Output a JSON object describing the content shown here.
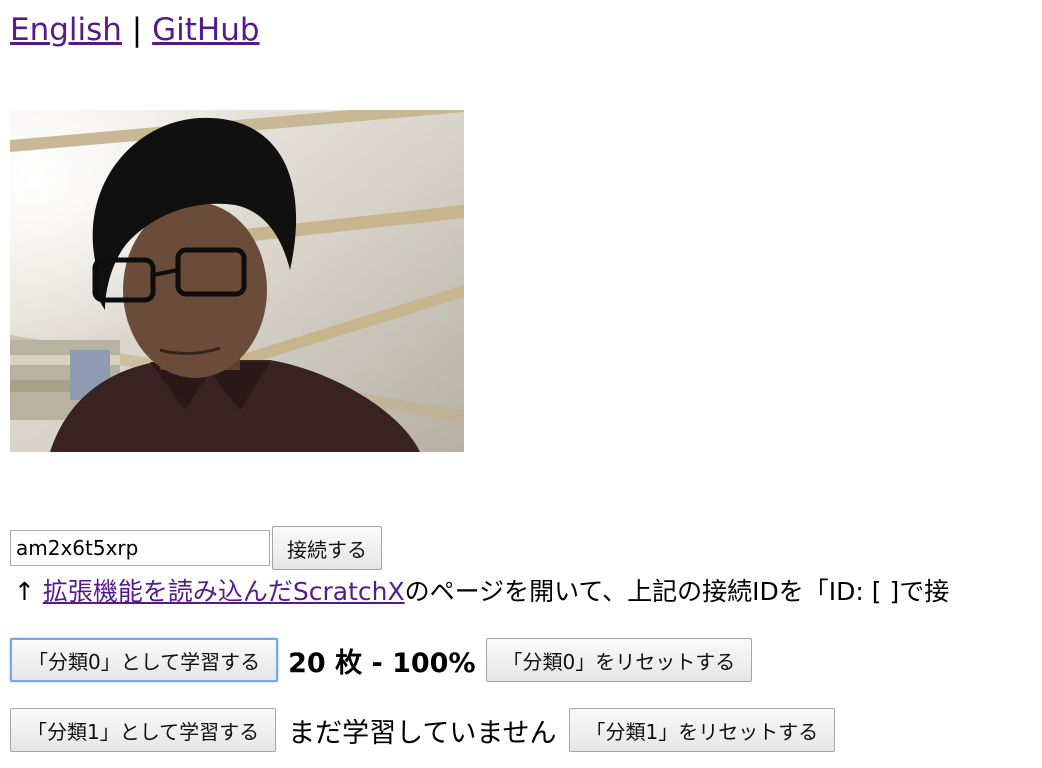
{
  "header": {
    "english_link": "English",
    "separator": "|",
    "github_link": "GitHub"
  },
  "camera": {
    "alt": "Webcam preview"
  },
  "connect": {
    "id_value": "am2x6t5xrp",
    "connect_button": "接続する"
  },
  "hint": {
    "arrow": "↑",
    "link_text": "拡張機能を読み込んだScratchX",
    "trailing_text": "のページを開いて、上記の接続IDを「ID: [ ]で接"
  },
  "classes": [
    {
      "train_label": "「分類0」として学習する",
      "status": "20 枚 - 100%",
      "reset_label": "「分類0」をリセットする"
    },
    {
      "train_label": "「分類1」として学習する",
      "status": "まだ学習していません",
      "reset_label": "「分類1」をリセットする"
    }
  ],
  "colors": {
    "link": "#551a8b",
    "focus_ring": "#76a7e0"
  }
}
